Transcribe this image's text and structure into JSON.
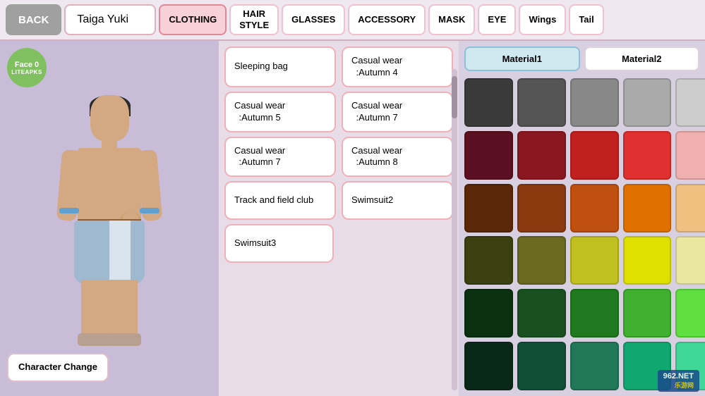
{
  "nav": {
    "back_label": "BACK",
    "character_name": "Taiga Yuki",
    "tabs": [
      {
        "id": "clothing",
        "label": "CLOTHING",
        "active": true
      },
      {
        "id": "hairstyle",
        "label": "HAIR\nSTYLE",
        "active": false
      },
      {
        "id": "glasses",
        "label": "GLASSES",
        "active": false
      },
      {
        "id": "accessory",
        "label": "ACCESSORY",
        "active": false
      },
      {
        "id": "mask",
        "label": "MASK",
        "active": false
      },
      {
        "id": "eye",
        "label": "EYE",
        "active": false
      },
      {
        "id": "wings",
        "label": "Wings",
        "active": false
      },
      {
        "id": "tail",
        "label": "Tail",
        "active": false
      }
    ]
  },
  "character": {
    "face_label": "Face 0",
    "brand_label": "LITEAPKS"
  },
  "character_change_btn": "Character\nChange",
  "clothing_list": {
    "rows": [
      [
        {
          "id": "sleeping-bag",
          "label": "Sleeping bag"
        },
        {
          "id": "casual-autumn-4",
          "label": "Casual wear\n:Autumn 4"
        }
      ],
      [
        {
          "id": "casual-autumn-5",
          "label": "Casual wear\n:Autumn 5"
        },
        {
          "id": "casual-autumn-7a",
          "label": "Casual wear\n:Autumn 7"
        }
      ],
      [
        {
          "id": "casual-autumn-7b",
          "label": "Casual wear\n:Autumn 7"
        },
        {
          "id": "casual-autumn-8",
          "label": "Casual wear\n:Autumn 8"
        }
      ],
      [
        {
          "id": "track-field",
          "label": "Track and field club"
        },
        {
          "id": "swimsuit2",
          "label": "Swimsuit2"
        }
      ],
      [
        {
          "id": "swimsuit3",
          "label": "Swimsuit3"
        },
        null
      ]
    ]
  },
  "color_panel": {
    "material1_label": "Material1",
    "material2_label": "Material2",
    "swatches": [
      "#3a3a3a",
      "#555555",
      "#888888",
      "#aaaaaa",
      "#cccccc",
      "#5a1020",
      "#8b1820",
      "#c02020",
      "#e03030",
      "#f0b0b0",
      "#5a2808",
      "#8b3a10",
      "#c05010",
      "#e07000",
      "#f0c080",
      "#3a4010",
      "#6a6a20",
      "#c0c020",
      "#e0e000",
      "#e8e8a0",
      "#0a3010",
      "#1a5020",
      "#207820",
      "#40b030",
      "#60e040",
      "#0a2818",
      "#105038",
      "#207858",
      "#10a870",
      "#40d898"
    ]
  },
  "watermark": {
    "site": "962.NET",
    "sub": "乐游网"
  }
}
